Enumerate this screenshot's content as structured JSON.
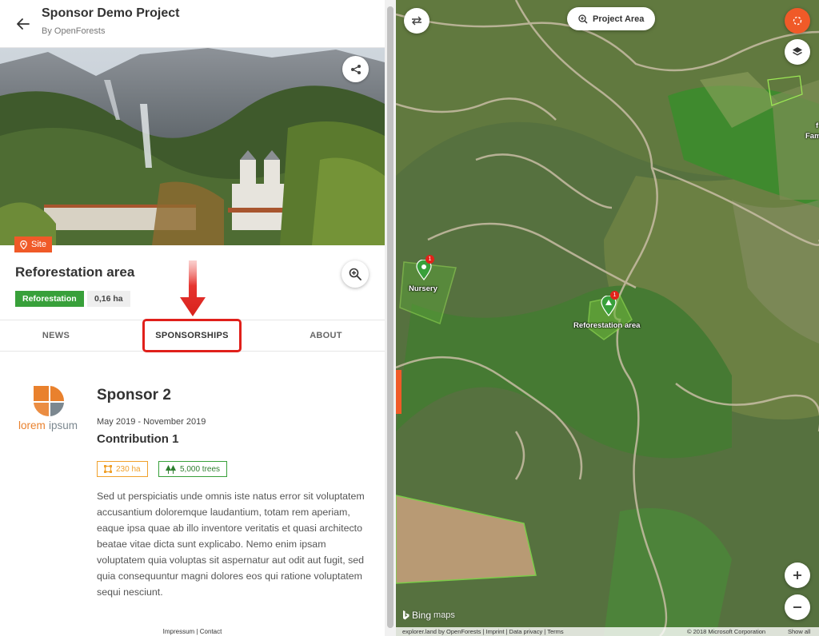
{
  "header": {
    "title": "Sponsor Demo Project",
    "subtitle": "By OpenForests"
  },
  "site": {
    "tag": "Site",
    "title": "Reforestation area",
    "type_badge": "Reforestation",
    "size_badge": "0,16 ha"
  },
  "tabs": [
    {
      "label": "NEWS"
    },
    {
      "label": "SPONSORSHIPS"
    },
    {
      "label": "ABOUT"
    }
  ],
  "sponsor": {
    "logo_text_1": "lorem",
    "logo_text_2": "ipsum",
    "name": "Sponsor 2",
    "dates": "May 2019 - November 2019",
    "contribution": "Contribution 1",
    "area": "230 ha",
    "trees": "5,000 trees",
    "description": "Sed ut perspiciatis unde omnis iste natus error sit voluptatem accusantium doloremque laudantium, totam rem aperiam, eaque ipsa quae ab illo inventore veritatis et quasi architecto beatae vitae dicta sunt explicabo. Nemo enim ipsam voluptatem quia voluptas sit aspernatur aut odit aut fugit, sed quia consequuntur magni dolores eos qui ratione voluptatem sequi nesciunt."
  },
  "footer": {
    "impressum": "Impressum",
    "separator": "|",
    "contact": "Contact"
  },
  "map": {
    "project_area_btn": "Project Area",
    "labels": {
      "nursery": "Nursery",
      "reforestation": "Reforestation area",
      "partial_1": "f",
      "partial_2": "Fam"
    },
    "pin_count_nursery": "1",
    "pin_count_reforestation": "1",
    "bing_logo": "Bing",
    "bing_maps": "maps",
    "footer_left": "explorer.land by OpenForests | Imprint | Data privacy | Terms",
    "footer_copyright": "© 2018 Microsoft Corporation",
    "footer_show_all": "Show all"
  },
  "colors": {
    "accent_orange": "#f05a28",
    "green": "#38a03a",
    "highlight_red": "#e0201b"
  },
  "icons": {
    "back": "arrow-left-icon",
    "share": "share-icon",
    "site": "map-pin-icon",
    "zoom": "zoom-in-icon",
    "area": "area-icon",
    "trees": "trees-icon",
    "swap": "swap-arrows-icon",
    "locate": "locate-icon",
    "layers": "layers-icon",
    "plus": "plus-icon",
    "minus": "minus-icon"
  }
}
